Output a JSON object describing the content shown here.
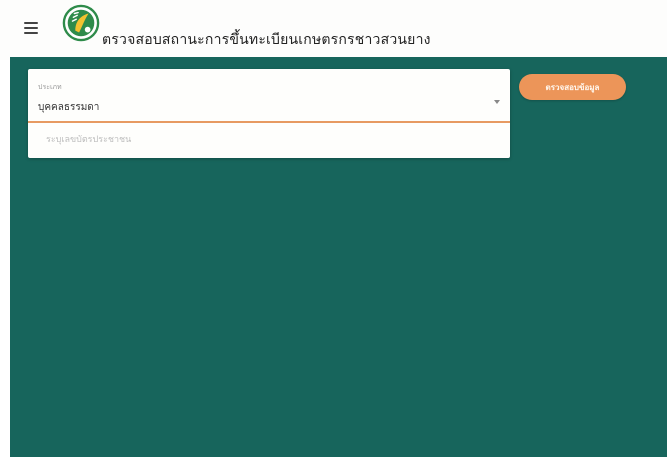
{
  "header": {
    "title": "ตรวจสอบสถานะการขึ้นทะเบียนเกษตรกรชาวสวนยาง"
  },
  "form": {
    "type_label": "ประเภท",
    "type_value": "บุคคลธรรมดา",
    "id_placeholder": "ระบุเลขบัตรประชาชน",
    "check_button_label": "ตรวจสอบข้อมูล"
  },
  "colors": {
    "main_background": "#17655c",
    "accent": "#ec9559",
    "logo_green": "#2e8b4a",
    "logo_yellow": "#f2c230"
  },
  "icons": {
    "menu": "hamburger-menu-icon",
    "logo": "rubber-tree-logo-icon",
    "select_caret": "caret-down-icon"
  }
}
